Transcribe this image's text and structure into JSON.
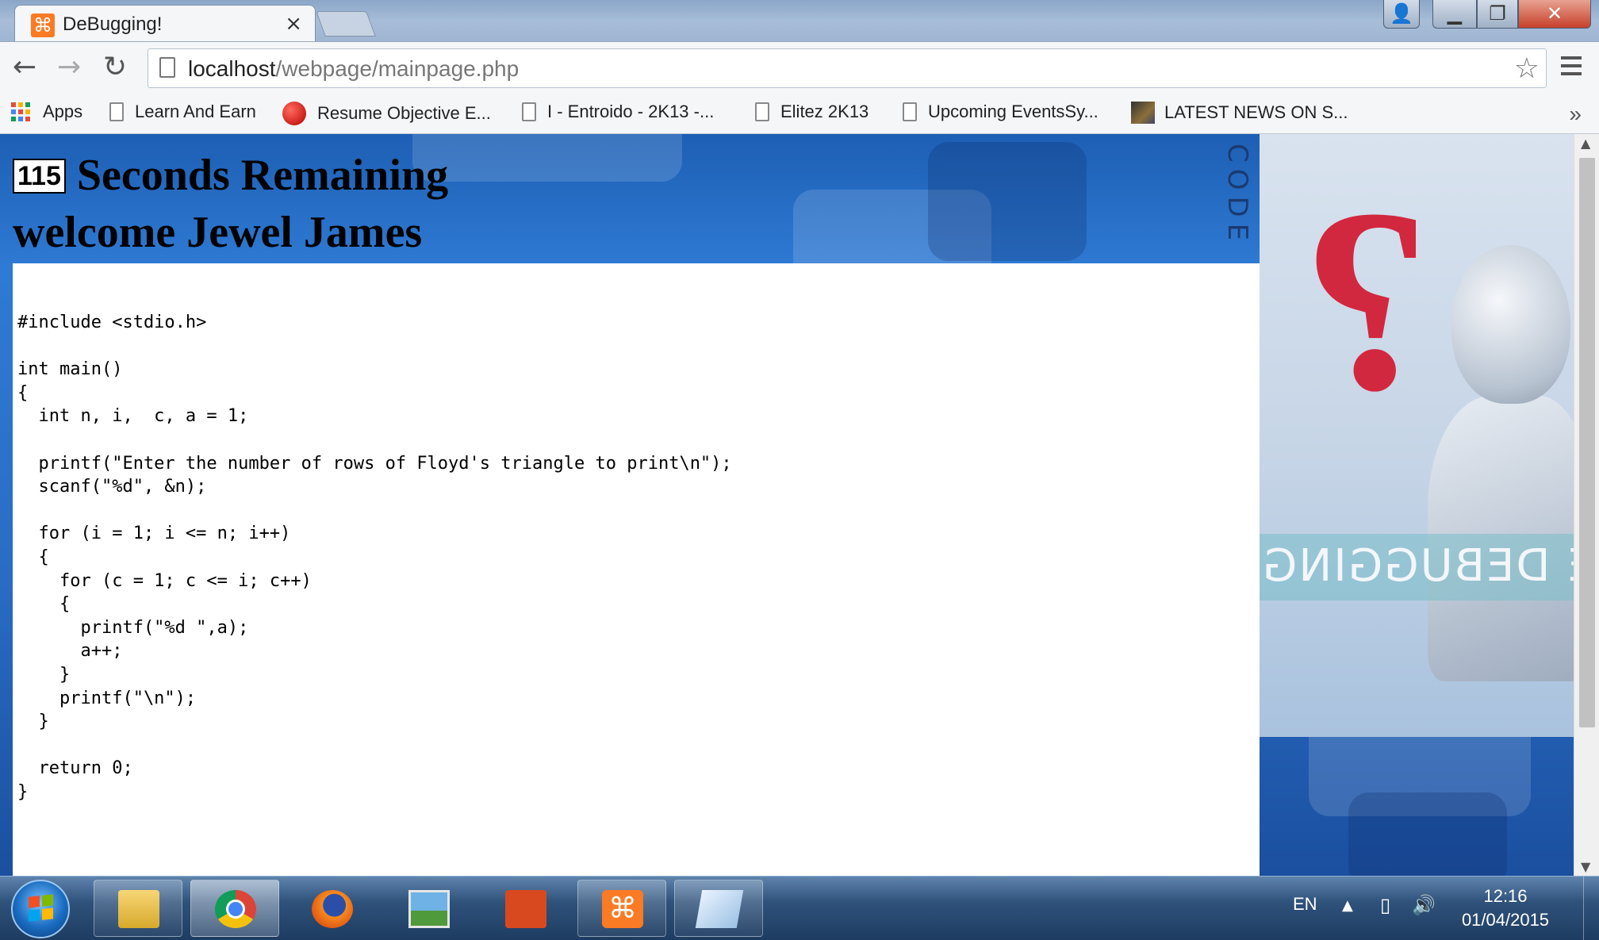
{
  "browser": {
    "tab_title": "DeBugging!",
    "tab_close": "×",
    "url_host": "localhost",
    "url_path": "/webpage/mainpage.php",
    "bookmarks": [
      {
        "label": "Apps"
      },
      {
        "label": "Learn And Earn"
      },
      {
        "label": "Resume Objective E..."
      },
      {
        "label": "I - Entroido - 2K13 -..."
      },
      {
        "label": "Elitez 2K13"
      },
      {
        "label": "Upcoming EventsSy..."
      },
      {
        "label": "LATEST NEWS ON S..."
      }
    ],
    "bookmarks_more": "»"
  },
  "page": {
    "timer_value": "115",
    "timer_label": "Seconds Remaining",
    "welcome": "welcome Jewel James",
    "code": "#include <stdio.h>\n\nint main()\n{\n  int n, i,  c, a = 1;\n\n  printf(\"Enter the number of rows of Floyd's triangle to print\\n\");\n  scanf(\"%d\", &n);\n\n  for (i = 1; i <= n; i++)\n  {\n    for (c = 1; c <= i; c++)\n    {\n      printf(\"%d \",a);\n      a++;\n    }\n    printf(\"\\n\");\n  }\n\n  return 0;\n}",
    "side_vertical_text": "CODE ?",
    "side_banner_text": "CODE DEBUGGING",
    "accent_color": "#d2283f"
  },
  "taskbar": {
    "apps": [
      "folder-icon",
      "chrome-icon",
      "firefox-icon",
      "photo-viewer-icon",
      "powerpoint-icon",
      "xampp-icon",
      "notepad-icon"
    ],
    "language": "EN",
    "time": "12:16",
    "date": "01/04/2015"
  }
}
